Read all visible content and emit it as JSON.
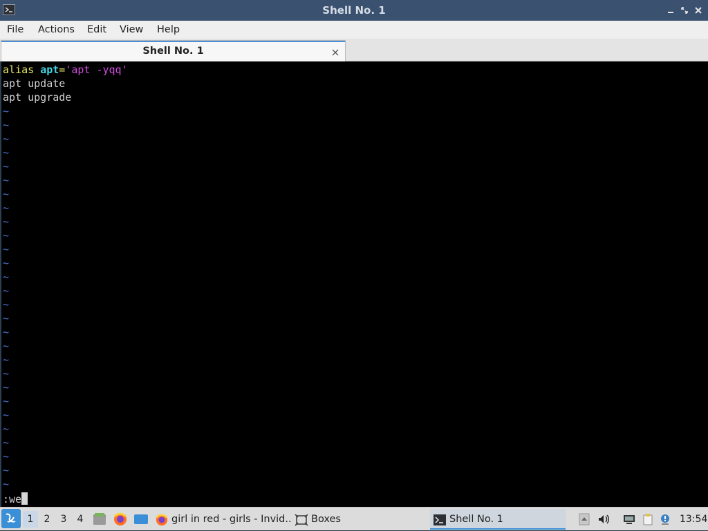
{
  "window": {
    "title": "Shell No. 1"
  },
  "menu": [
    "File",
    "Actions",
    "Edit",
    "View",
    "Help"
  ],
  "tab": {
    "label": "Shell No. 1"
  },
  "editor": {
    "lines": [
      {
        "segments": [
          {
            "text": "alias ",
            "color": "yellow"
          },
          {
            "text": "apt",
            "color": "cyan"
          },
          {
            "text": "=",
            "color": "yellow"
          },
          {
            "text": "'apt -yqq'",
            "color": "magenta"
          }
        ]
      },
      {
        "segments": [
          {
            "text": "apt update",
            "color": "default"
          }
        ]
      },
      {
        "segments": [
          {
            "text": "apt upgrade",
            "color": "default"
          }
        ]
      }
    ],
    "empty_line_marker": "~",
    "empty_line_count": 28,
    "command_line": ":we"
  },
  "taskbar": {
    "workspaces": [
      "1",
      "2",
      "3",
      "4"
    ],
    "active_workspace": "1",
    "tasks": [
      {
        "label": "girl in red - girls - Invid...",
        "icon": "firefox-icon"
      },
      {
        "label": "Boxes",
        "icon": "boxes-icon"
      },
      {
        "label": "Shell No. 1",
        "icon": "terminal-icon",
        "active": true
      }
    ],
    "clock": "13:54"
  },
  "colors": {
    "titlebar": "#3b5170",
    "accent": "#3b8fd6",
    "terminal_bg": "#000000",
    "tilde": "#4f74d6"
  }
}
